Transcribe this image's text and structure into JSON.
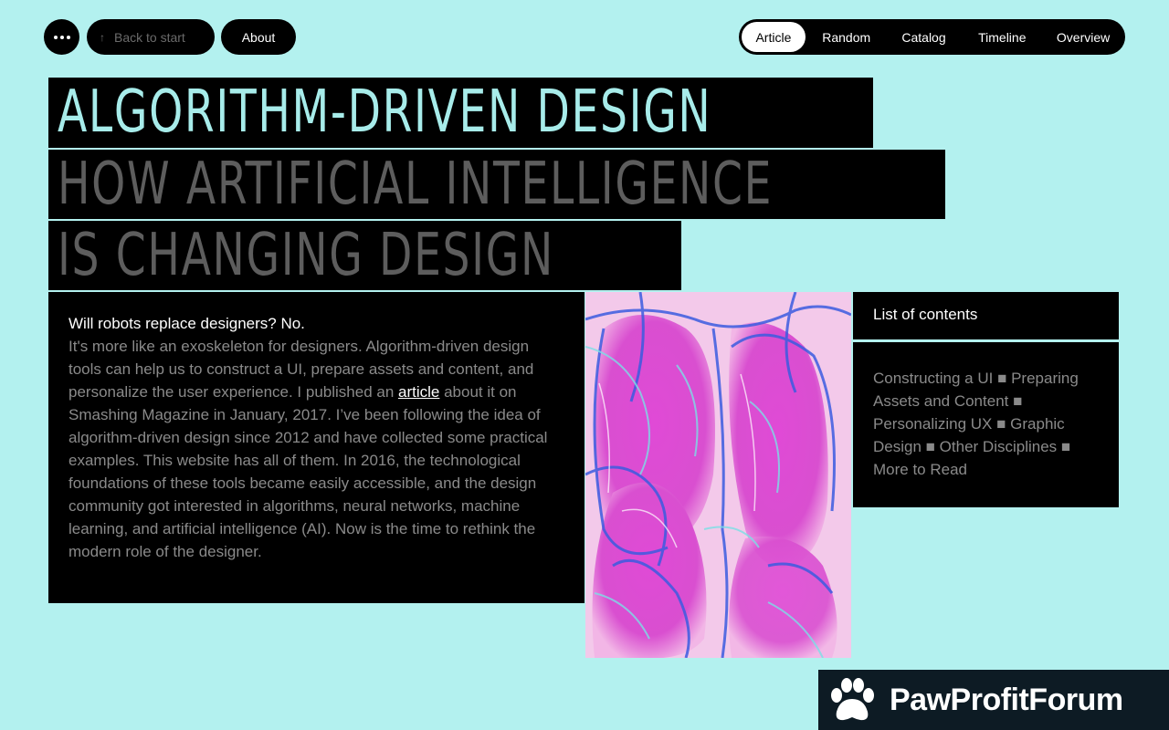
{
  "nav": {
    "back_label": "Back to start",
    "about_label": "About",
    "tabs": [
      {
        "label": "Article",
        "active": true
      },
      {
        "label": "Random"
      },
      {
        "label": "Catalog"
      },
      {
        "label": "Timeline"
      },
      {
        "label": "Overview"
      }
    ]
  },
  "headline": {
    "line1": "ALGORITHM-DRIVEN DESIGN",
    "line2": "HOW ARTIFICIAL INTELLIGENCE",
    "line3": "IS CHANGING DESIGN"
  },
  "intro": {
    "lead": "Will robots replace designers? No.",
    "before_link": "It's more like an exoskeleton for designers. Algorithm-driven design tools can help us to construct a UI, prepare assets and content, and personalize the user experience. I published an ",
    "link": "article",
    "after_link": " about it on Smashing Magazine in January, 2017. I’ve been following the idea of algorithm-driven design since 2012 and have collected some practical examples. This website has all of them. In 2016, the technological foundations of these tools became easily accessible, and the design community got interested in algorithms, neural networks, machine learning, and artificial intelligence (AI). Now is the time to rethink the modern role of the designer."
  },
  "toc": {
    "title": "List of contents",
    "items": [
      "Constructing a UI",
      "Preparing Assets and Content",
      "Personalizing UX",
      "Graphic Design",
      "Other Disciplines",
      "More to Read"
    ],
    "separator": "■"
  },
  "brand": {
    "name": "PawProfitForum"
  },
  "colors": {
    "background": "#b3f1ef",
    "headline_accent": "#a7ecea",
    "panel": "#000000",
    "muted_text": "#8a8a8a"
  }
}
